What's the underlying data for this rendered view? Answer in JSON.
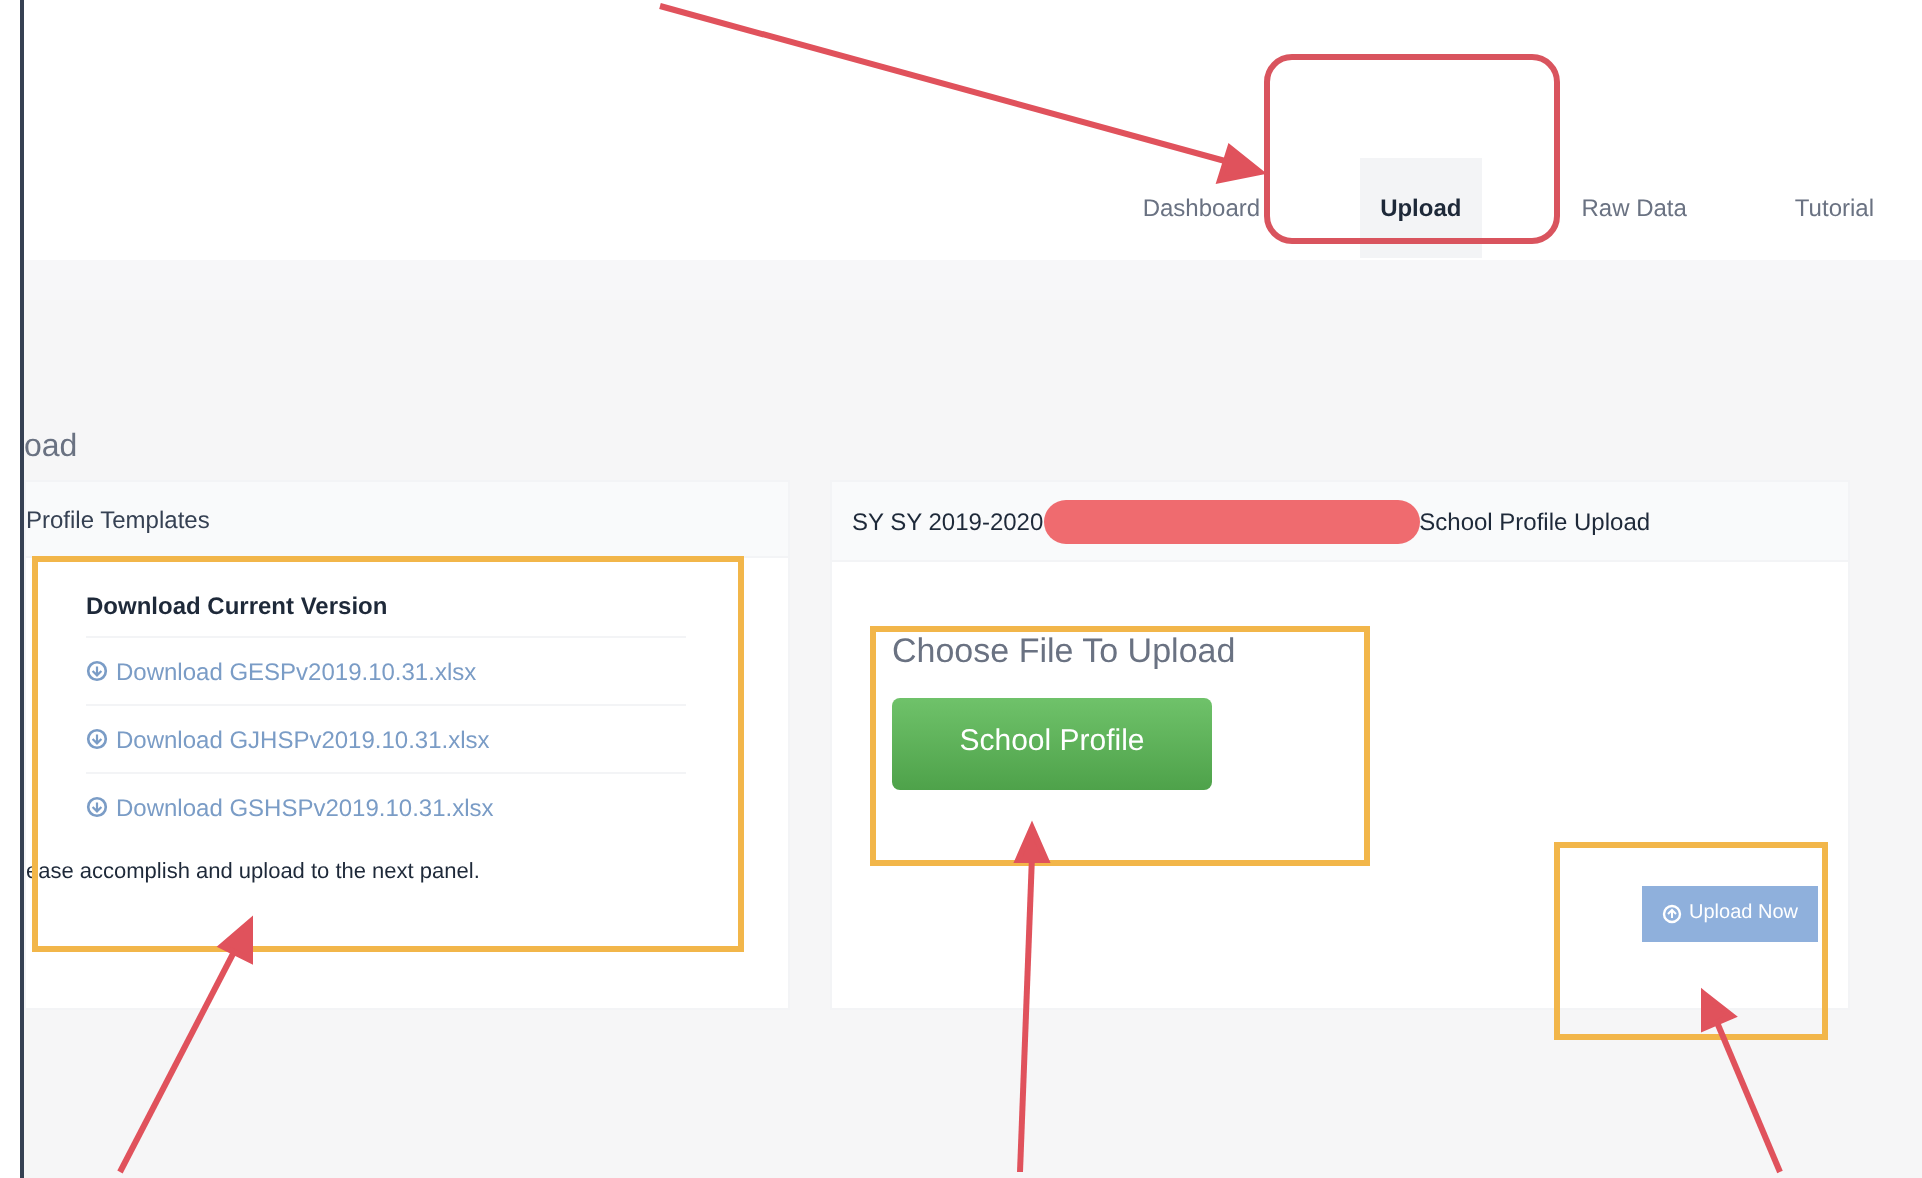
{
  "nav": [
    {
      "label": "Dashboard",
      "selected": false
    },
    {
      "label": "Upload",
      "selected": true
    },
    {
      "label": "Raw Data",
      "selected": false
    },
    {
      "label": "Tutorial",
      "selected": false
    }
  ],
  "page_heading": "oad",
  "templates_panel": {
    "title": "Profile Templates",
    "subtitle": "Download Current Version",
    "links": [
      "Download GESPv2019.10.31.xlsx",
      "Download GJHSPv2019.10.31.xlsx",
      "Download GSHSPv2019.10.31.xlsx"
    ],
    "note": "ease accomplish and upload to the next panel."
  },
  "upload_panel": {
    "title_start": "SY SY 2019-2020",
    "title_end": "School Profile Upload",
    "label": "Choose File To Upload",
    "file_button": "School Profile",
    "submit_button": "Upload Now"
  }
}
